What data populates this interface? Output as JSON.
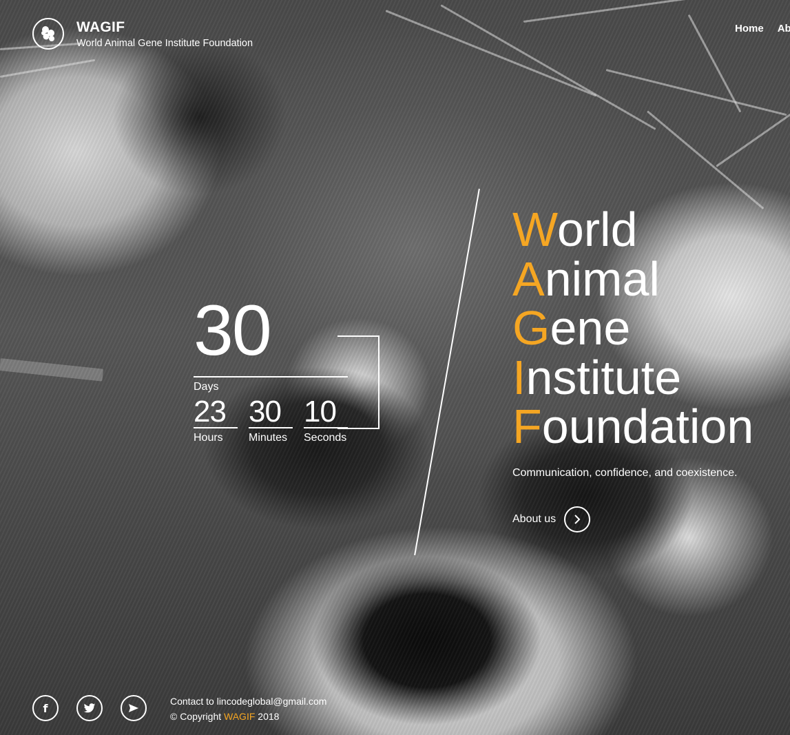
{
  "header": {
    "logo_icon": "dna-cells-icon",
    "title": "WAGIF",
    "subtitle": "World Animal Gene Institute Foundation",
    "nav": [
      "Home",
      "Abo"
    ]
  },
  "countdown": {
    "days": "30",
    "days_label": "Days",
    "units": [
      {
        "value": "23",
        "label": "Hours"
      },
      {
        "value": "30",
        "label": "Minutes"
      },
      {
        "value": "10",
        "label": "Seconds"
      }
    ]
  },
  "hero": {
    "lines": [
      {
        "first": "W",
        "rest": "orld"
      },
      {
        "first": "A",
        "rest": "nimal"
      },
      {
        "first": "G",
        "rest": "ene"
      },
      {
        "first": "I",
        "rest": "nstitute"
      },
      {
        "first": "F",
        "rest": "oundation"
      }
    ],
    "tagline": "Communication, confidence, and coexistence.",
    "about_label": "About us",
    "accent_color": "#f5a623"
  },
  "footer": {
    "social": [
      {
        "name": "facebook-icon",
        "glyph": "f"
      },
      {
        "name": "twitter-icon",
        "glyph": ""
      },
      {
        "name": "send-icon",
        "glyph": ""
      }
    ],
    "contact": "Contact to lincodeglobal@gmail.com",
    "copyright_prefix": "© Copyright ",
    "copyright_brand": "WAGIF",
    "copyright_year": " 2018"
  }
}
